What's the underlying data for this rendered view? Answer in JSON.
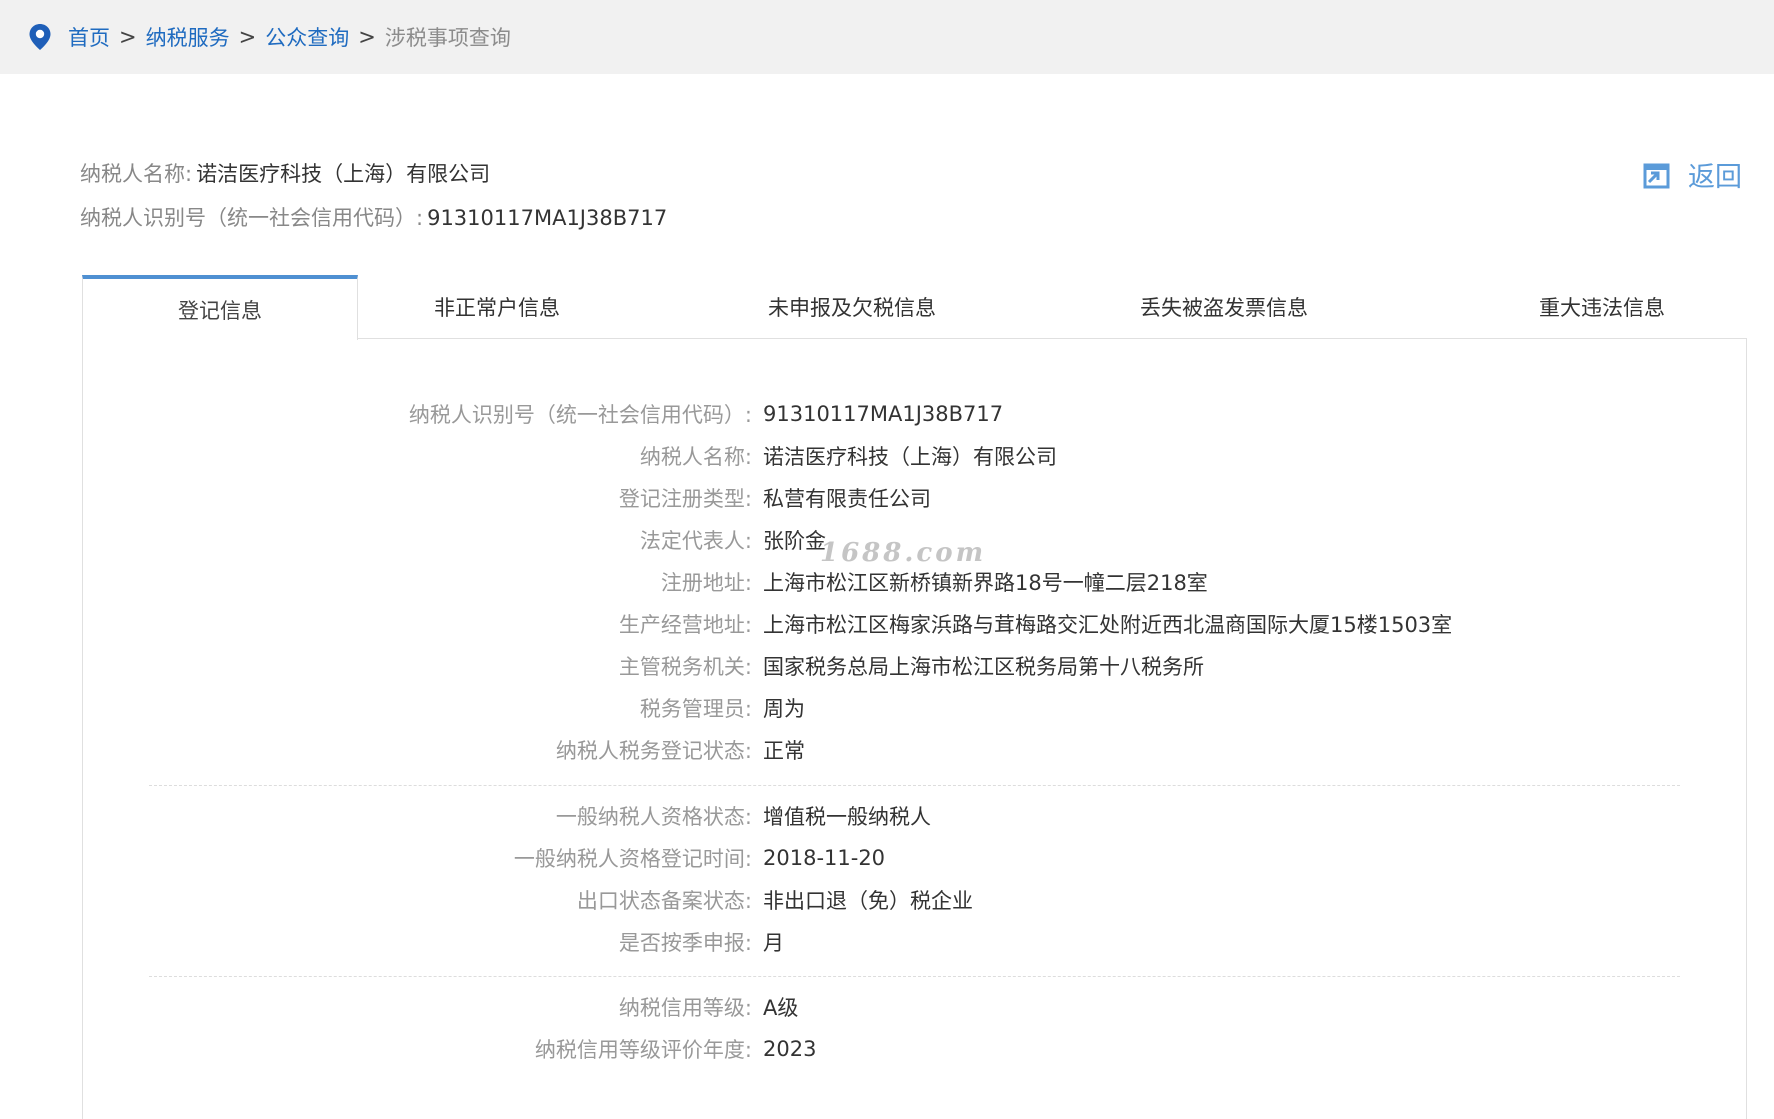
{
  "breadcrumb": {
    "items": [
      "首页",
      "纳税服务",
      "公众查询"
    ],
    "separator": ">",
    "current": "涉税事项查询"
  },
  "header": {
    "name_label": "纳税人名称:",
    "name_value": "诺洁医疗科技（上海）有限公司",
    "id_label": "纳税人识别号（统一社会信用代码）:",
    "id_value": "91310117MA1J38B717"
  },
  "return_label": "返回",
  "tabs": [
    {
      "label": "登记信息",
      "active": true
    },
    {
      "label": "非正常户信息",
      "active": false
    },
    {
      "label": "未申报及欠税信息",
      "active": false
    },
    {
      "label": "丢失被盗发票信息",
      "active": false
    },
    {
      "label": "重大违法信息",
      "active": false
    }
  ],
  "registration": {
    "group1": [
      {
        "label": "纳税人识别号（统一社会信用代码）:",
        "value": "91310117MA1J38B717"
      },
      {
        "label": "纳税人名称:",
        "value": "诺洁医疗科技（上海）有限公司"
      },
      {
        "label": "登记注册类型:",
        "value": "私营有限责任公司"
      },
      {
        "label": "法定代表人:",
        "value": "张阶金"
      },
      {
        "label": "注册地址:",
        "value": "上海市松江区新桥镇新界路18号一幢二层218室"
      },
      {
        "label": "生产经营地址:",
        "value": "上海市松江区梅家浜路与茸梅路交汇处附近西北温商国际大厦15楼1503室"
      },
      {
        "label": "主管税务机关:",
        "value": "国家税务总局上海市松江区税务局第十八税务所"
      },
      {
        "label": "税务管理员:",
        "value": "周为"
      },
      {
        "label": "纳税人税务登记状态:",
        "value": "正常"
      }
    ],
    "group2": [
      {
        "label": "一般纳税人资格状态:",
        "value": "增值税一般纳税人"
      },
      {
        "label": "一般纳税人资格登记时间:",
        "value": "2018-11-20"
      },
      {
        "label": "出口状态备案状态:",
        "value": "非出口退（免）税企业"
      },
      {
        "label": "是否按季申报:",
        "value": "月"
      }
    ],
    "group3": [
      {
        "label": "纳税信用等级:",
        "value": "A级"
      },
      {
        "label": "纳税信用等级评价年度:",
        "value": "2023"
      }
    ]
  },
  "watermark": "1688.com",
  "colors": {
    "link": "#1f6bc0",
    "accent": "#4f90d2",
    "return": "#5b9bd9",
    "label": "#999999"
  },
  "icons": {
    "location": "location-pin-icon",
    "return": "return-arrow-icon"
  }
}
